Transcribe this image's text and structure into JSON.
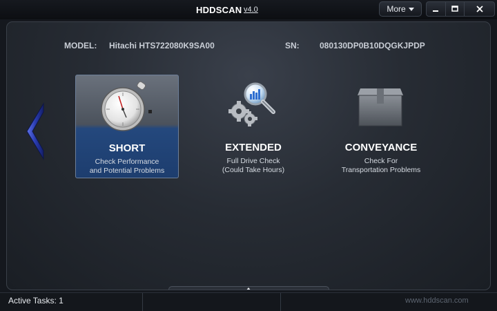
{
  "window": {
    "title": "HDDSCAN",
    "version": "v4.0",
    "more_label": "More"
  },
  "drive": {
    "model_label": "MODEL:",
    "model_value": "Hitachi HTS722080K9SA00",
    "sn_label": "SN:",
    "sn_value": "080130DP0B10DQGKJPDP"
  },
  "tests": [
    {
      "title": "SHORT",
      "desc_line1": "Check Performance",
      "desc_line2": "and Potential Problems",
      "icon": "stopwatch-icon",
      "selected": true
    },
    {
      "title": "EXTENDED",
      "desc_line1": "Full Drive Check",
      "desc_line2": "(Could Take Hours)",
      "icon": "gears-magnifier-icon",
      "selected": false
    },
    {
      "title": "CONVEYANCE",
      "desc_line1": "Check For",
      "desc_line2": "Transportation Problems",
      "icon": "box-icon",
      "selected": false
    }
  ],
  "status": {
    "active_tasks": "Active Tasks: 1",
    "website": "www.hddscan.com"
  },
  "colors": {
    "selection": "#1d3d6e",
    "nav_arrow": "#2b3fae"
  }
}
